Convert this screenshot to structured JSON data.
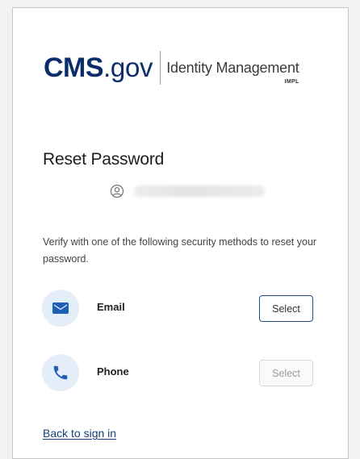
{
  "logo": {
    "cms": "CMS",
    "gov": ".gov",
    "product": "Identity Management",
    "environment": "IMPL"
  },
  "page": {
    "title": "Reset Password",
    "instructions": "Verify with one of the following security methods to reset your password."
  },
  "methods": [
    {
      "label": "Email",
      "icon": "email-icon",
      "button": "Select"
    },
    {
      "label": "Phone",
      "icon": "phone-icon",
      "button": "Select"
    }
  ],
  "links": {
    "back": "Back to sign in"
  },
  "colors": {
    "brand": "#0c2d6b",
    "link": "#1a3e78",
    "icon_bg": "#e3eef9",
    "icon_fg": "#1e5fb5"
  }
}
